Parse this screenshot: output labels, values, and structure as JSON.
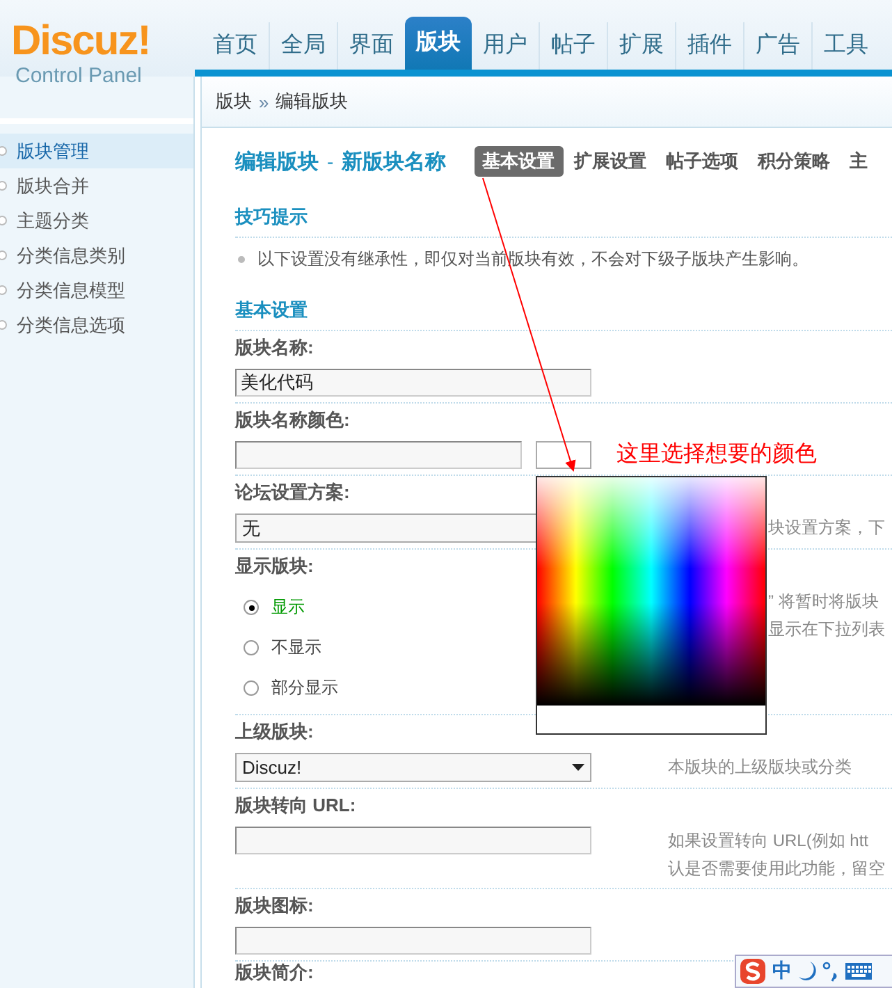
{
  "logo": {
    "name": "Discuz!",
    "subtitle": "Control Panel"
  },
  "nav": [
    {
      "label": "首页",
      "selected": false
    },
    {
      "label": "全局",
      "selected": false
    },
    {
      "label": "界面",
      "selected": false
    },
    {
      "label": "版块",
      "selected": true
    },
    {
      "label": "用户",
      "selected": false
    },
    {
      "label": "帖子",
      "selected": false
    },
    {
      "label": "扩展",
      "selected": false
    },
    {
      "label": "插件",
      "selected": false
    },
    {
      "label": "广告",
      "selected": false
    },
    {
      "label": "工具",
      "selected": false
    }
  ],
  "breadcrumb": {
    "items": [
      "版块",
      "编辑版块"
    ],
    "separator": "»"
  },
  "sidebar": [
    {
      "label": "版块管理",
      "selected": true
    },
    {
      "label": "版块合并",
      "selected": false
    },
    {
      "label": "主题分类",
      "selected": false
    },
    {
      "label": "分类信息类别",
      "selected": false
    },
    {
      "label": "分类信息模型",
      "selected": false
    },
    {
      "label": "分类信息选项",
      "selected": false
    }
  ],
  "page_title": {
    "title": "编辑版块",
    "dash": "-",
    "subtitle": "新版块名称"
  },
  "sub_tabs": [
    {
      "label": "基本设置",
      "selected": true
    },
    {
      "label": "扩展设置",
      "selected": false
    },
    {
      "label": "帖子选项",
      "selected": false
    },
    {
      "label": "积分策略",
      "selected": false
    },
    {
      "label": "主",
      "selected": false
    }
  ],
  "tips": {
    "heading": "技巧提示",
    "items": [
      "以下设置没有继承性，即仅对当前版块有效，不会对下级子版块产生影响。"
    ]
  },
  "section_heading": "基本设置",
  "fields": [
    {
      "kind": "text",
      "label": "版块名称:",
      "value": "美化代码"
    },
    {
      "kind": "color",
      "label": "版块名称颜色:"
    },
    {
      "kind": "select",
      "label": "论坛设置方案:",
      "value": "无",
      "note": [
        "块设置方案，下"
      ],
      "note_beside_picker": true
    },
    {
      "kind": "radios",
      "label": "显示版块:",
      "options": [
        {
          "label": "显示",
          "selected": true
        },
        {
          "label": "不显示",
          "selected": false
        },
        {
          "label": "部分显示",
          "selected": false
        }
      ],
      "note": [
        "” 将暂时将版块",
        "显示在下拉列表"
      ],
      "note_beside_picker": true
    },
    {
      "kind": "select",
      "label": "上级版块:",
      "value": "Discuz!",
      "note": [
        "本版块的上级版块或分类"
      ]
    },
    {
      "kind": "text",
      "label": "版块转向 URL:",
      "note": [
        "如果设置转向 URL(例如 htt",
        "认是否需要使用此功能，留空"
      ]
    },
    {
      "kind": "text",
      "label": "版块图标:"
    },
    {
      "kind": "label",
      "label": "版块简介:"
    }
  ],
  "color_picker": {
    "open": true
  },
  "annotation": {
    "text": "这里选择想要的颜色"
  },
  "ime_bar": {
    "mode": "中"
  }
}
